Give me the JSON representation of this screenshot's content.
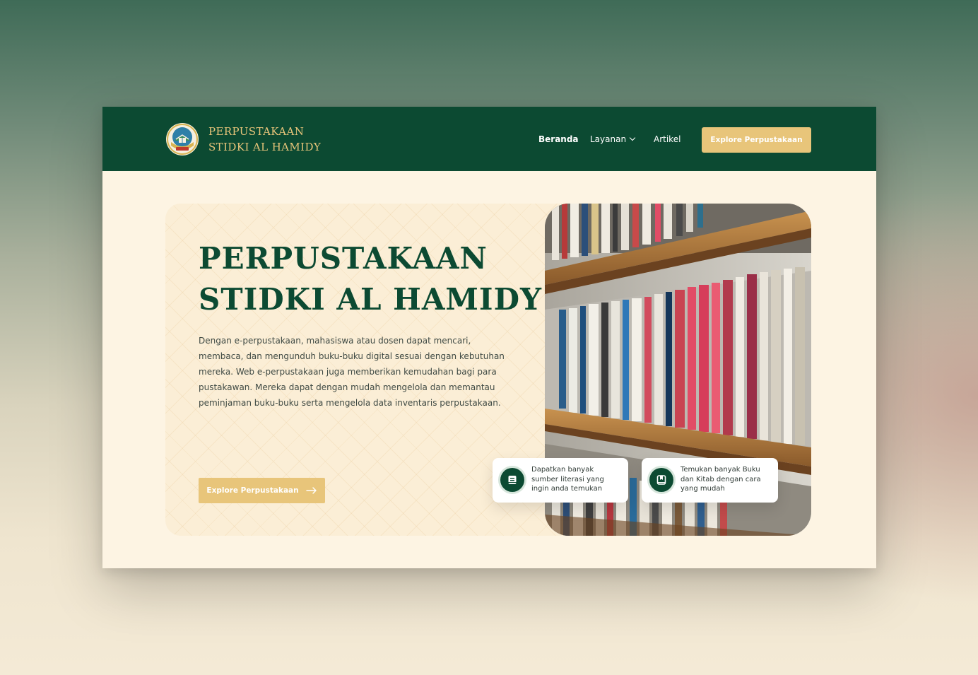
{
  "colors": {
    "primary_green": "#0c4a32",
    "accent_gold": "#e8c57a",
    "cream_background": "#fdf4e3",
    "text_dark": "#3f4a44"
  },
  "navbar": {
    "logo_icon": "stidki-emblem-icon",
    "brand_line1": "PERPUSTAKAAN",
    "brand_line2": "STIDKI AL HAMIDY",
    "links": [
      {
        "label": "Beranda",
        "active": true
      },
      {
        "label": "Layanan",
        "has_dropdown": true,
        "icon": "chevron-down-icon"
      },
      {
        "label": "Artikel"
      }
    ],
    "cta_label": "Explore Perpustakaan"
  },
  "hero": {
    "title_line1": "PERPUSTAKAAN",
    "title_line2": "STIDKI AL HAMIDY",
    "description": "Dengan e-perpustakaan, mahasiswa atau dosen dapat mencari, membaca, dan mengunduh buku-buku digital sesuai dengan kebutuhan mereka. Web e-perpustakaan juga memberikan kemudahan bagi para pustakawan. Mereka dapat dengan mudah mengelola dan memantau peminjaman buku-buku serta mengelola data inventaris perpustakaan.",
    "cta_label": "Explore Perpustakaan",
    "cta_icon": "arrow-right-icon",
    "image": "bookshelf-photo"
  },
  "features": [
    {
      "icon": "book-stack-icon",
      "text": "Dapatkan banyak sumber literasi yang ingin anda temukan"
    },
    {
      "icon": "bookmark-book-icon",
      "text": "Temukan banyak Buku dan Kitab dengan cara yang mudah"
    }
  ]
}
